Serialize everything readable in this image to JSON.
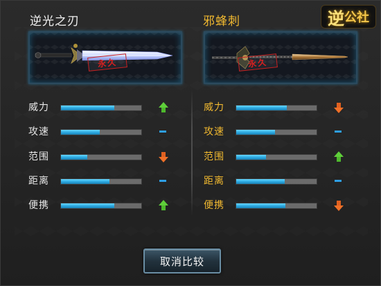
{
  "logo": {
    "text_big": "逆",
    "text_small": "公社"
  },
  "left": {
    "title": "逆光之刃",
    "stamp": "永久",
    "stats": [
      {
        "label": "威力",
        "level": 0.66,
        "change": "up"
      },
      {
        "label": "攻速",
        "level": 0.48,
        "change": "same"
      },
      {
        "label": "范围",
        "level": 0.33,
        "change": "down"
      },
      {
        "label": "距离",
        "level": 0.6,
        "change": "same"
      },
      {
        "label": "便携",
        "level": 0.66,
        "change": "up"
      }
    ]
  },
  "right": {
    "title": "邪蜂刺",
    "stamp": "永久",
    "stats": [
      {
        "label": "威力",
        "level": 0.63,
        "change": "down"
      },
      {
        "label": "攻速",
        "level": 0.48,
        "change": "same"
      },
      {
        "label": "范围",
        "level": 0.37,
        "change": "up"
      },
      {
        "label": "距离",
        "level": 0.6,
        "change": "same"
      },
      {
        "label": "便携",
        "level": 0.61,
        "change": "down"
      }
    ]
  },
  "actions": {
    "cancel_label": "取消比较"
  },
  "colors": {
    "bar_fill": "#2aa8e0",
    "up": "#5fcf3a",
    "down": "#f07028",
    "same": "#2e9fe6",
    "right_text": "#f0b830"
  }
}
